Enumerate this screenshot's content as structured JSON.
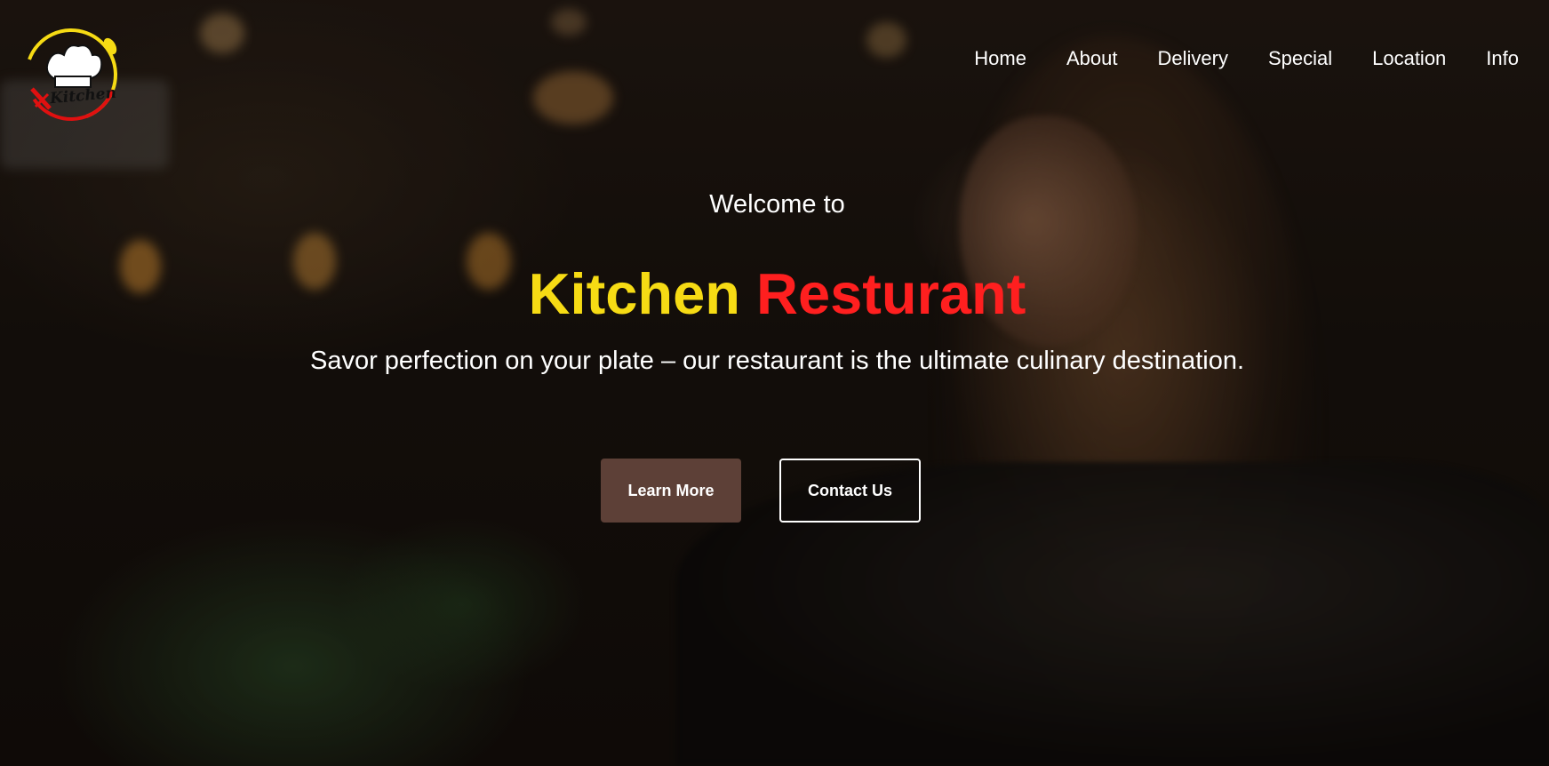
{
  "logo": {
    "text": "Kitchen",
    "icon": "chef-hat-icon"
  },
  "nav": {
    "items": [
      "Home",
      "About",
      "Delivery",
      "Special",
      "Location",
      "Info"
    ]
  },
  "hero": {
    "welcome": "Welcome to",
    "title_part1": "Kitchen",
    "title_part2": "Resturant",
    "tagline": "Savor perfection on your plate – our restaurant is the ultimate culinary destination.",
    "learn_more_label": "Learn More",
    "contact_label": "Contact Us"
  },
  "colors": {
    "title_yellow": "#f6db14",
    "title_red": "#ff1f1f",
    "button_brown": "#5d4037"
  }
}
